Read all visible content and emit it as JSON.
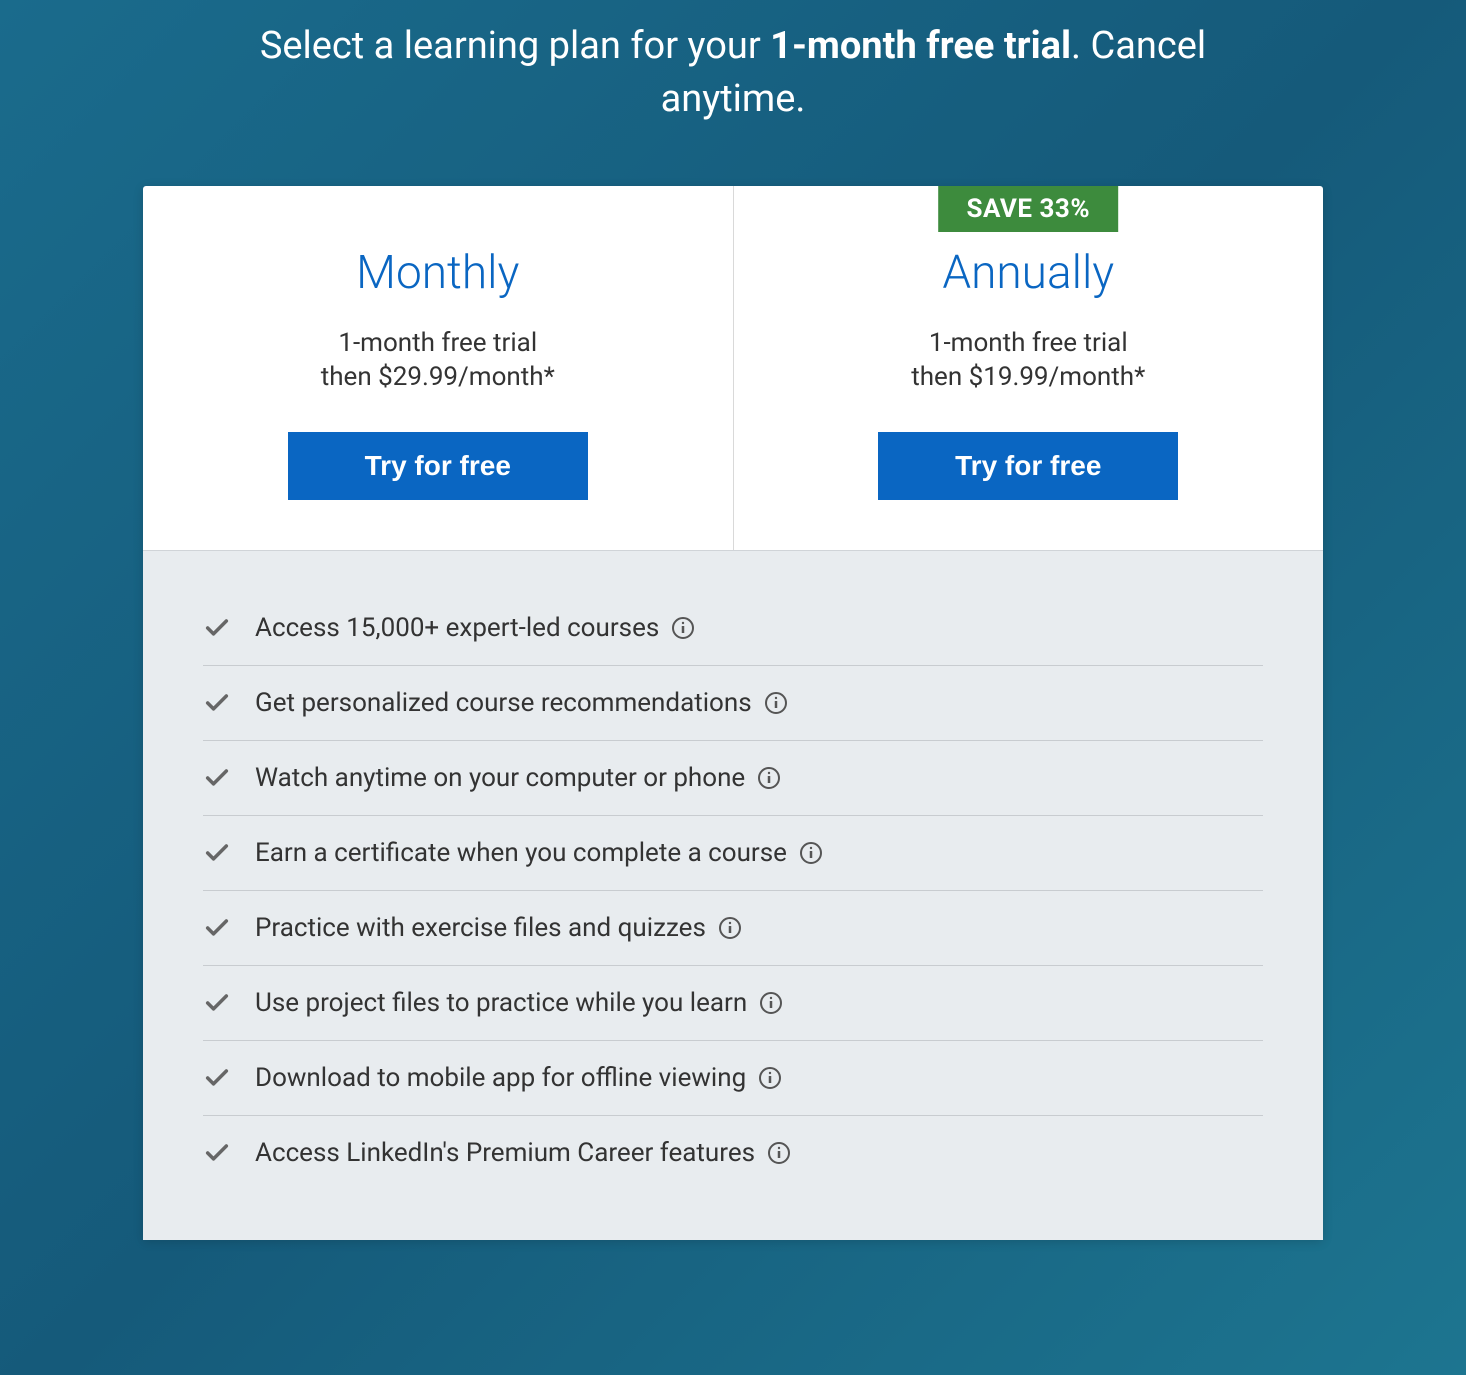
{
  "header": {
    "prefix": "Select a learning plan for your ",
    "bold": "1-month free trial",
    "suffix": ". Cancel anytime."
  },
  "plans": [
    {
      "title": "Monthly",
      "trial": "1-month free trial",
      "price": "then $29.99/month*",
      "button": "Try for free",
      "badge": null
    },
    {
      "title": "Annually",
      "trial": "1-month free trial",
      "price": "then $19.99/month*",
      "button": "Try for free",
      "badge": "SAVE 33%"
    }
  ],
  "features": [
    "Access 15,000+ expert-led courses",
    "Get personalized course recommendations",
    "Watch anytime on your computer or phone",
    "Earn a certificate when you complete a course",
    "Practice with exercise files and quizzes",
    "Use project files to practice while you learn",
    "Download to mobile app for offline viewing",
    "Access LinkedIn's Premium Career features"
  ]
}
